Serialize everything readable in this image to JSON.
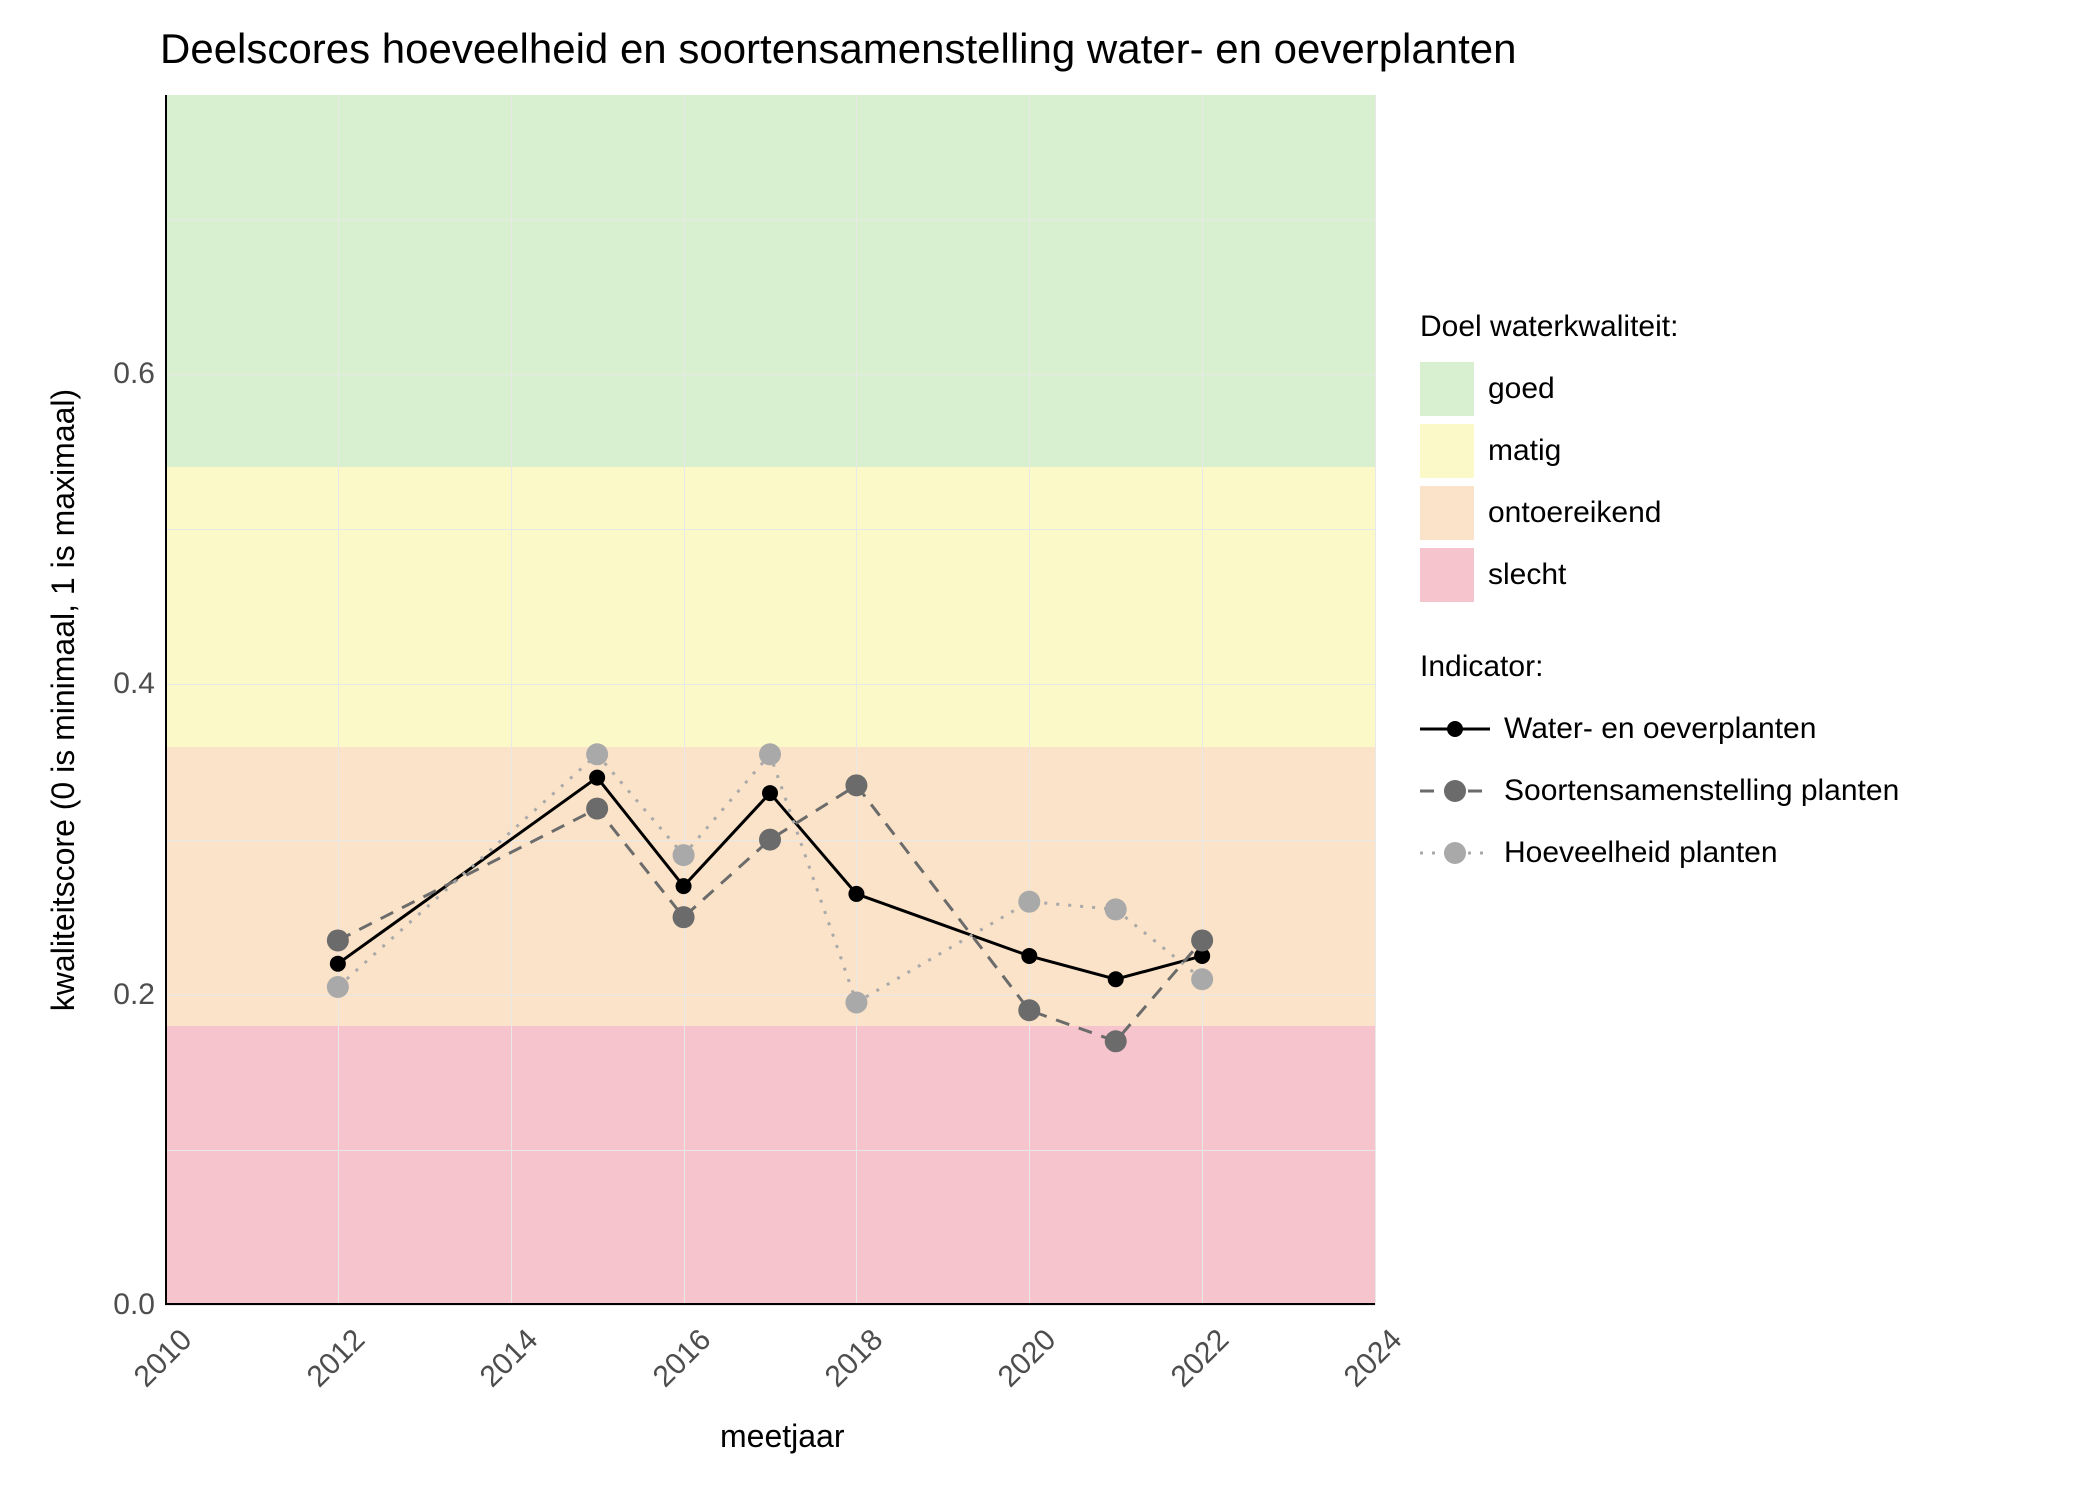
{
  "chart_data": {
    "type": "line",
    "title": "Deelscores hoeveelheid en soortensamenstelling water- en oeverplanten",
    "xlabel": "meetjaar",
    "ylabel": "kwaliteitscore (0 is minimaal, 1 is maximaal)",
    "xlim": [
      2010,
      2024
    ],
    "ylim": [
      0.0,
      0.78
    ],
    "x_ticks": [
      2010,
      2012,
      2014,
      2016,
      2018,
      2020,
      2022,
      2024
    ],
    "y_ticks": [
      0.0,
      0.2,
      0.4,
      0.6
    ],
    "quality_bands": [
      {
        "name": "slecht",
        "color": "#f6c4cc",
        "from": 0.0,
        "to": 0.18
      },
      {
        "name": "ontoereikend",
        "color": "#fae3c8",
        "from": 0.18,
        "to": 0.36
      },
      {
        "name": "matig",
        "color": "#fbf9c8",
        "from": 0.36,
        "to": 0.54
      },
      {
        "name": "goed",
        "color": "#d8efd0",
        "from": 0.54,
        "to": 0.78
      }
    ],
    "series": [
      {
        "name": "Water- en oeverplanten",
        "color": "#000000",
        "marker_fill": "#000000",
        "line_style": "solid",
        "x": [
          2012,
          2015,
          2016,
          2017,
          2018,
          2020,
          2021,
          2022
        ],
        "y": [
          0.22,
          0.34,
          0.27,
          0.33,
          0.265,
          0.225,
          0.21,
          0.225
        ]
      },
      {
        "name": "Soortensamenstelling planten",
        "color": "#6b6b6b",
        "marker_fill": "#6b6b6b",
        "line_style": "dashed",
        "x": [
          2012,
          2015,
          2016,
          2017,
          2018,
          2020,
          2021,
          2022
        ],
        "y": [
          0.235,
          0.32,
          0.25,
          0.3,
          0.335,
          0.19,
          0.17,
          0.235
        ]
      },
      {
        "name": "Hoeveelheid planten",
        "color": "#a9a9a9",
        "marker_fill": "#a9a9a9",
        "line_style": "dotted",
        "x": [
          2012,
          2015,
          2016,
          2017,
          2018,
          2020,
          2021,
          2022
        ],
        "y": [
          0.205,
          0.355,
          0.29,
          0.355,
          0.195,
          0.26,
          0.255,
          0.21
        ]
      }
    ],
    "legend1_title": "Doel waterkwaliteit:",
    "legend1_items": [
      {
        "label": "goed",
        "color": "#d8efd0"
      },
      {
        "label": "matig",
        "color": "#fbf9c8"
      },
      {
        "label": "ontoereikend",
        "color": "#fae3c8"
      },
      {
        "label": "slecht",
        "color": "#f6c4cc"
      }
    ],
    "legend2_title": "Indicator:"
  }
}
